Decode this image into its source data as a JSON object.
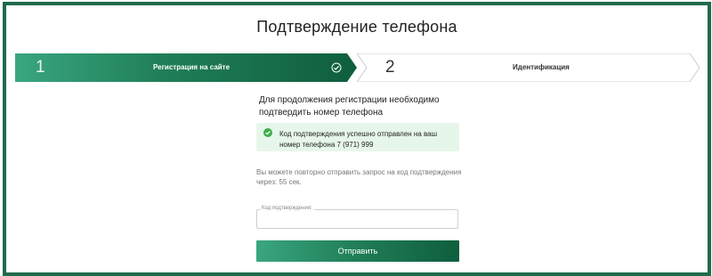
{
  "page": {
    "title": "Подтверждение телефона"
  },
  "steps": [
    {
      "number": "1",
      "label": "Регистрация на сайте",
      "status": "completed"
    },
    {
      "number": "2",
      "label": "Идентификация",
      "status": "current"
    }
  ],
  "form": {
    "intro": "Для продолжения регистрации необходимо подтвердить номер телефона",
    "alert": "Код подтверждения успешно отправлен на ваш номер телефона 7 (971) 999",
    "resend_note": "Вы можете повторно отправить запрос на код подтверждения через: 55 сек.",
    "code_label": "Код подтверждения:",
    "code_value": "",
    "submit_label": "Отправить"
  },
  "colors": {
    "frame": "#1f6b4b",
    "accent_start": "#3aa67f",
    "accent_end": "#0f5e3e",
    "success_bg": "#e7f6ea",
    "success_icon": "#3fae49"
  },
  "icons": {
    "step_done": "check-circle-icon",
    "alert": "check-circle-icon"
  }
}
